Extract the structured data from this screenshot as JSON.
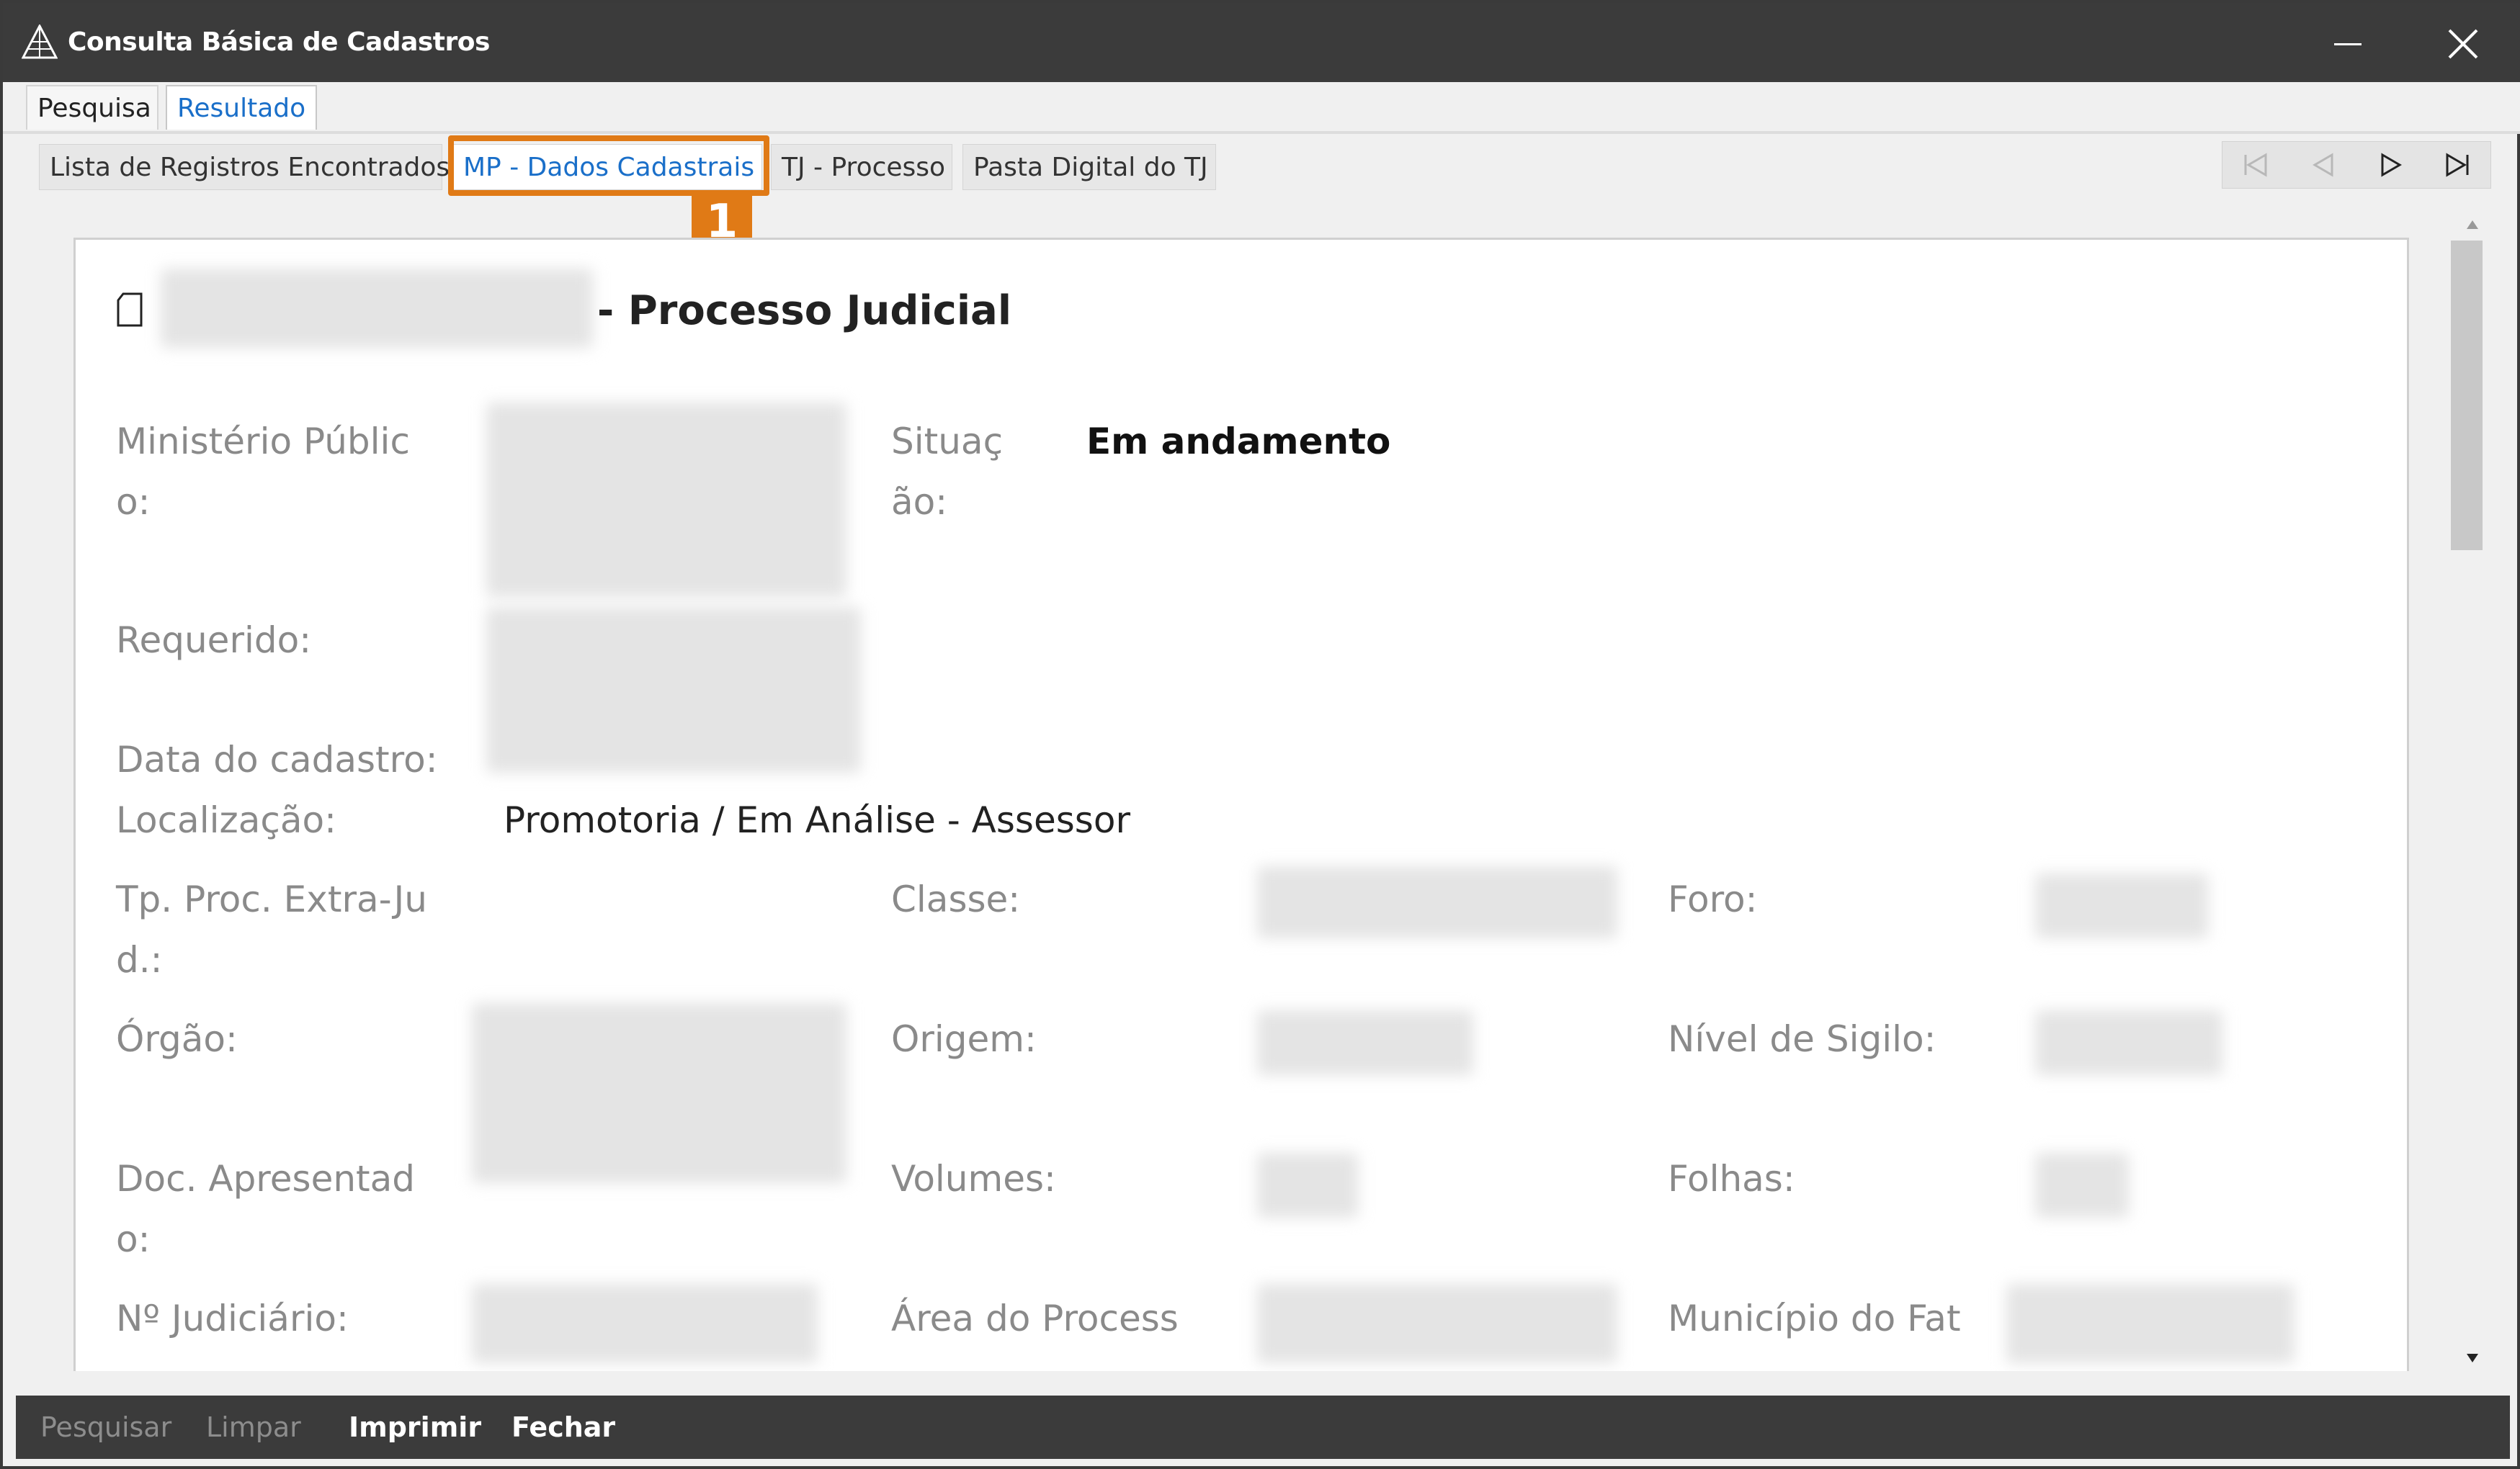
{
  "window": {
    "title": "Consulta Básica de Cadastros"
  },
  "top_tabs": [
    {
      "label": "Pesquisa",
      "active": false
    },
    {
      "label": "Resultado",
      "active": true
    }
  ],
  "sub_tabs": [
    {
      "label": "Lista de Registros Encontrados",
      "active": false
    },
    {
      "label": "MP - Dados Cadastrais",
      "active": true
    },
    {
      "label": "TJ - Processo",
      "active": false
    },
    {
      "label": "Pasta Digital do TJ",
      "active": false
    }
  ],
  "callout": {
    "number": "1",
    "color": "#e07a16"
  },
  "navigation": {
    "icons": [
      "first-record-icon",
      "previous-record-icon",
      "next-record-icon",
      "last-record-icon"
    ],
    "first_enabled": false,
    "previous_enabled": false,
    "next_enabled": true,
    "last_enabled": true
  },
  "record": {
    "title_suffix": "- Processo Judicial",
    "fields": {
      "ministerio_publico": {
        "label": "Ministério Públic\no:"
      },
      "situacao": {
        "label": "Situaç\não:",
        "value": "Em andamento"
      },
      "requerido": {
        "label": "Requerido:"
      },
      "data_cadastro": {
        "label": "Data do cadastro:"
      },
      "localizacao": {
        "label": "Localização:",
        "value": "Promotoria / Em Análise - Assessor"
      },
      "tp_proc": {
        "label": "Tp. Proc. Extra-Ju\nd.:"
      },
      "classe": {
        "label": "Classe:"
      },
      "foro": {
        "label": "Foro:"
      },
      "orgao": {
        "label": "Órgão:"
      },
      "origem": {
        "label": "Origem:"
      },
      "nivel_sigilo": {
        "label": "Nível de Sigilo:"
      },
      "doc_apresentado": {
        "label": "Doc. Apresentad\no:"
      },
      "volumes": {
        "label": "Volumes:"
      },
      "folhas": {
        "label": "Folhas:"
      },
      "num_judiciario": {
        "label": "Nº Judiciário:"
      },
      "area_processo": {
        "label": "Área do Process"
      },
      "municipio": {
        "label": "Município do Fat"
      }
    }
  },
  "footer_buttons": [
    {
      "label": "Pesquisar",
      "enabled": false
    },
    {
      "label": "Limpar",
      "enabled": false
    },
    {
      "label": "Imprimir",
      "enabled": true
    },
    {
      "label": "Fechar",
      "enabled": true
    }
  ],
  "colors": {
    "titlebar": "#3b3b3b",
    "accent": "#1a6fc9",
    "highlight": "#e07a16"
  }
}
